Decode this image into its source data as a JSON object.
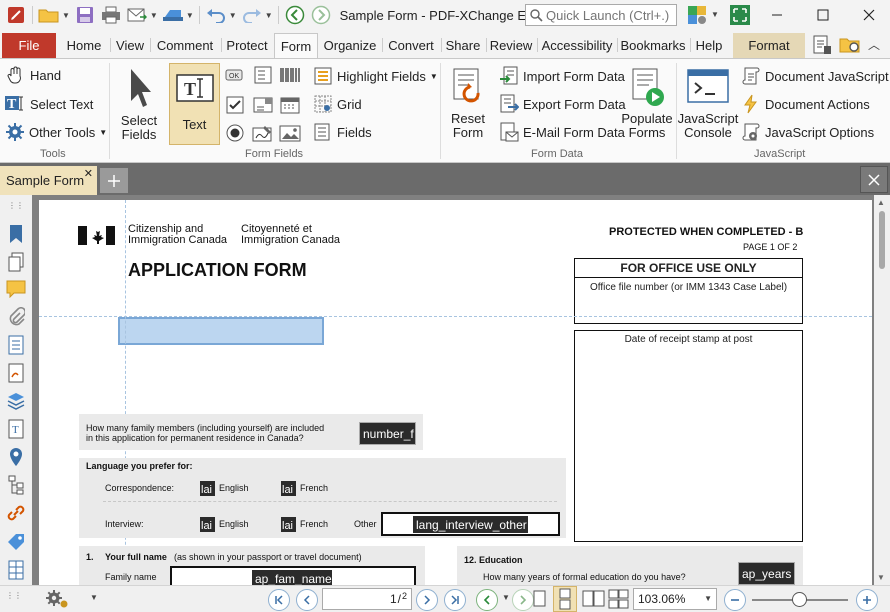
{
  "window": {
    "title": "Sample Form - PDF-XChange E...",
    "quick_launch_placeholder": "Quick Launch (Ctrl+.)"
  },
  "ribbon_tabs": [
    "File",
    "Home",
    "View",
    "Comment",
    "Protect",
    "Form",
    "Organize",
    "Convert",
    "Share",
    "Review",
    "Accessibility",
    "Bookmarks",
    "Help",
    "Format"
  ],
  "active_tab": "Form",
  "ribbon": {
    "tools": {
      "hand": "Hand",
      "select_text": "Select Text",
      "other_tools": "Other Tools",
      "group": "Tools"
    },
    "form_fields": {
      "select_fields": [
        "Select",
        "Fields"
      ],
      "text": "Text",
      "highlight_fields": "Highlight Fields",
      "grid": "Grid",
      "fields": "Fields",
      "group": "Form Fields"
    },
    "form_data": {
      "reset_form": [
        "Reset",
        "Form"
      ],
      "import": "Import Form Data",
      "export": "Export Form Data",
      "email": "E-Mail Form Data",
      "populate": [
        "Populate",
        "Forms"
      ],
      "group": "Form Data"
    },
    "javascript": {
      "console": [
        "JavaScript",
        "Console"
      ],
      "document_js": "Document JavaScript",
      "document_actions": "Document Actions",
      "js_options": "JavaScript Options",
      "group": "JavaScript"
    }
  },
  "doc_tab": {
    "name": "Sample Form"
  },
  "document": {
    "dept_en": [
      "Citizenship and",
      "Immigration Canada"
    ],
    "dept_fr": [
      "Citoyenneté et",
      "Immigration Canada"
    ],
    "protected": "PROTECTED WHEN COMPLETED - B",
    "page_of": "PAGE 1 OF 2",
    "title": "APPLICATION FORM",
    "office_use": "FOR OFFICE USE ONLY",
    "office_file": "Office file number (or IMM 1343 Case Label)",
    "receipt_stamp": "Date of receipt stamp at post",
    "family_q": [
      "How many family members (including yourself) are included",
      "in this application for permanent residence in Canada?"
    ],
    "family_field": "number_f",
    "lang_header": "Language you prefer for:",
    "correspondence": "Correspondence:",
    "interview": "Interview:",
    "english": "English",
    "french": "French",
    "other": "Other",
    "lang_other_field": "lang_interview_other",
    "checkbox_text": "lai",
    "q1_num": "1.",
    "q1_label": "Your full name",
    "q1_sub": "(as shown in your passport or travel document)",
    "family_name": "Family name",
    "fam_field": "ap_fam_name",
    "q12": "12.  Education",
    "q12_sub": "How many years of formal education do you have?",
    "years_field": "ap_years"
  },
  "status": {
    "page": "1",
    "page_total": "2",
    "zoom": "103.06%"
  },
  "colors": {
    "file_tab": "#c0392b",
    "format_tab": "#e5d8b6",
    "selected_button": "#f1e1b4",
    "doc_tab": "#f0e2bb",
    "selected_field": "#bcd6f0"
  }
}
